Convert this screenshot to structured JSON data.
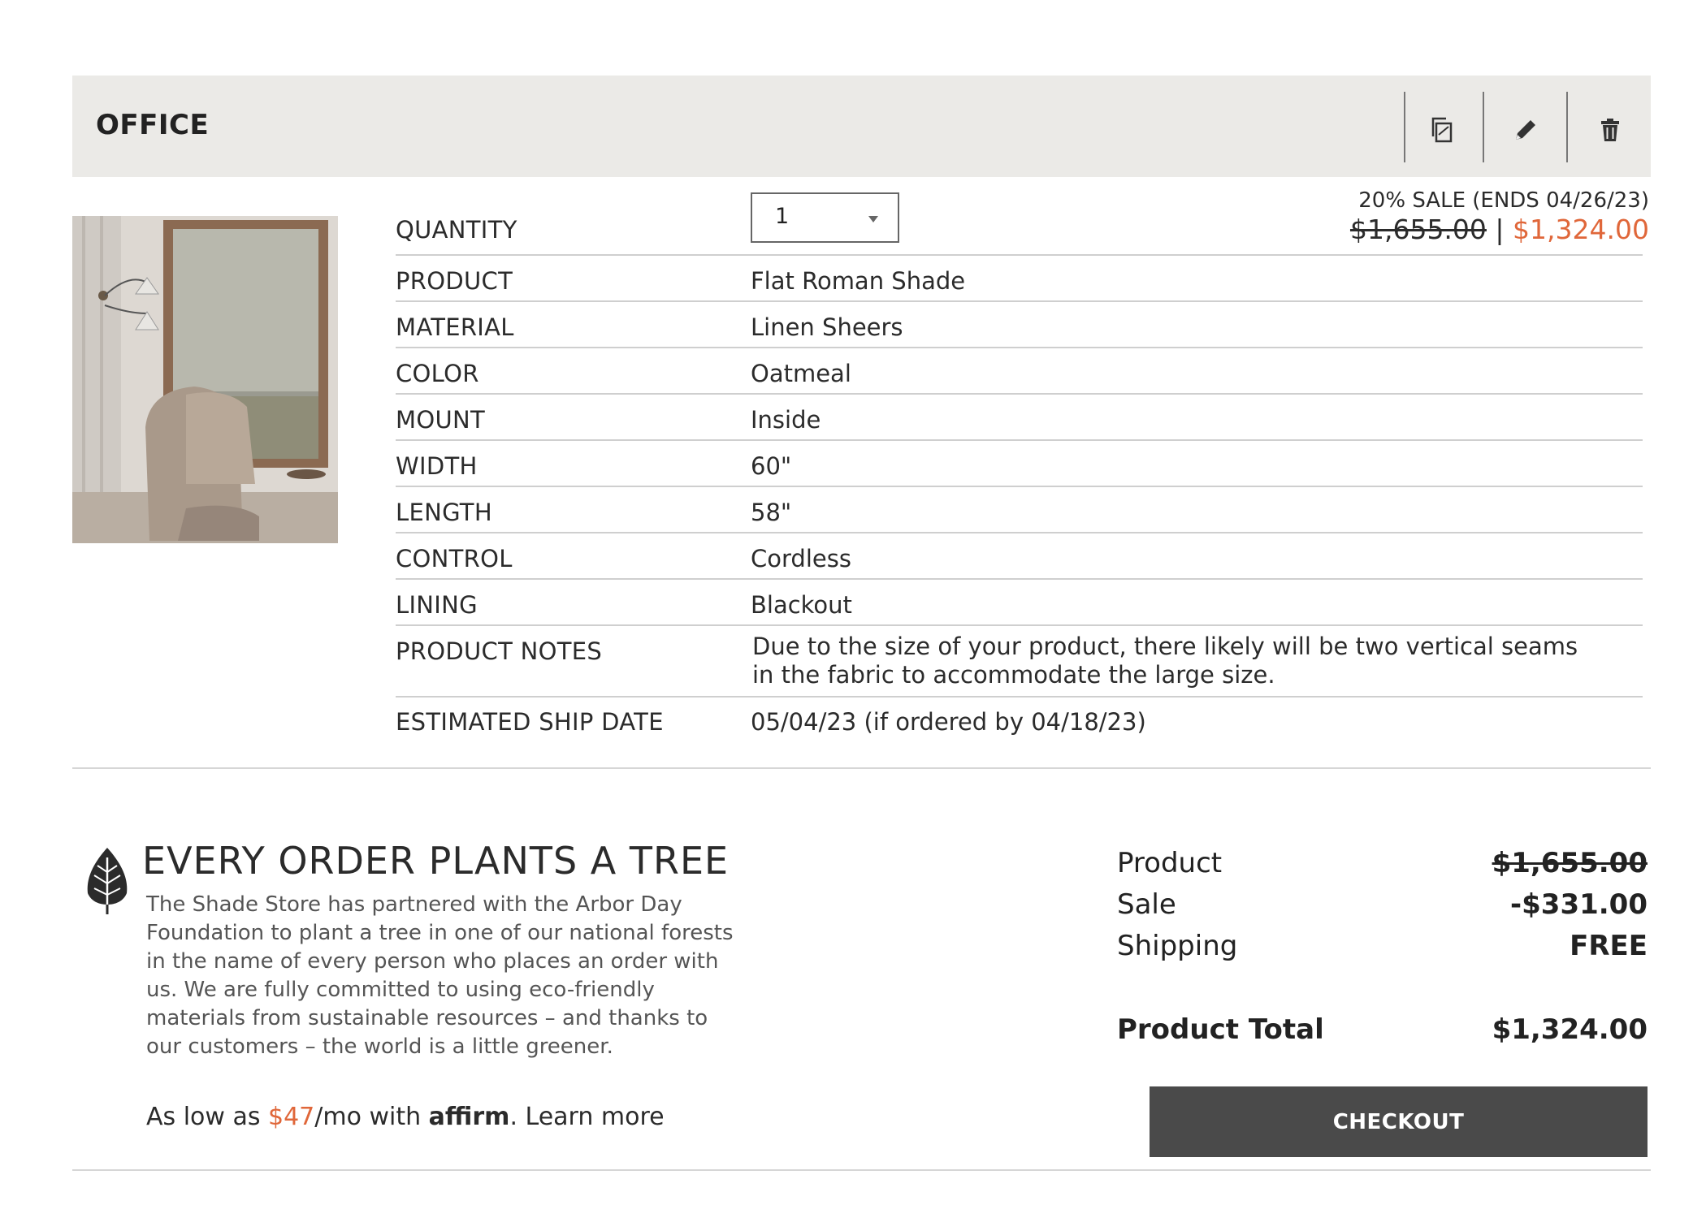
{
  "room": {
    "title": "OFFICE",
    "actions": [
      {
        "icon": "copy-icon"
      },
      {
        "icon": "pencil-icon"
      },
      {
        "icon": "trash-icon"
      }
    ]
  },
  "item": {
    "quantity_label": "QUANTITY",
    "quantity_value": "1",
    "sale_text": "20% SALE (ENDS 04/26/23)",
    "original_price": "$1,655.00",
    "price_separator": "|",
    "sale_price": "$1,324.00",
    "specs": [
      {
        "label": "PRODUCT",
        "value": "Flat Roman Shade"
      },
      {
        "label": "MATERIAL",
        "value": "Linen Sheers"
      },
      {
        "label": "COLOR",
        "value": "Oatmeal"
      },
      {
        "label": "MOUNT",
        "value": "Inside"
      },
      {
        "label": "WIDTH",
        "value": "60\""
      },
      {
        "label": "LENGTH",
        "value": "58\""
      },
      {
        "label": "CONTROL",
        "value": "Cordless"
      },
      {
        "label": "LINING",
        "value": "Blackout"
      }
    ],
    "notes_label": "PRODUCT NOTES",
    "notes_value": "Due to the size of your product, there likely will be two vertical seams in the fabric to accommodate the large size.",
    "ship_label": "ESTIMATED SHIP DATE",
    "ship_value": "05/04/23 (if ordered by 04/18/23)"
  },
  "tree": {
    "icon": "leaf-icon",
    "title": "EVERY ORDER PLANTS A TREE",
    "body": "The Shade Store has partnered with the Arbor Day Foundation to plant a tree in one of our national forests in the name of every person who places an order with us. We are fully committed to using eco-friendly materials from sustainable resources – and thanks to our customers – the world is a little greener."
  },
  "affirm": {
    "prefix": "As low as ",
    "amount": "$47",
    "suffix": "/mo with ",
    "brand": "affirm",
    "learn_more": ". Learn more"
  },
  "summary": {
    "product_label": "Product",
    "product_value": "$1,655.00",
    "sale_label": "Sale",
    "sale_value": "-$331.00",
    "shipping_label": "Shipping",
    "shipping_value": "FREE",
    "total_label": "Product Total",
    "total_value": "$1,324.00",
    "checkout_label": "CHECKOUT"
  },
  "colors": {
    "accent": "#e0673a",
    "bar_bg": "#ebeae7",
    "button_bg": "#4a4a4a"
  }
}
